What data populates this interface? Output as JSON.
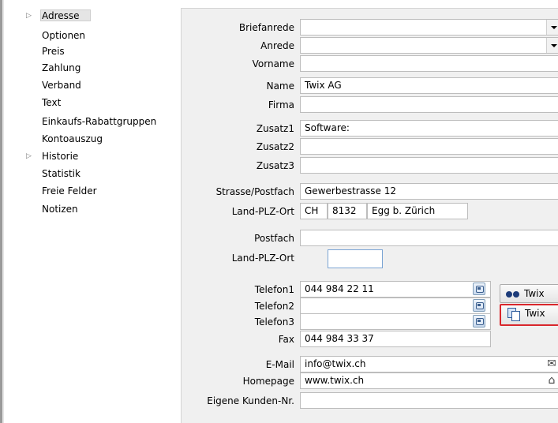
{
  "sidebar": {
    "items": [
      {
        "label": "Adresse",
        "expander": "▷",
        "selected": true
      },
      {
        "label": "Optionen"
      },
      {
        "label": "Preis"
      },
      {
        "label": "Zahlung"
      },
      {
        "label": "Verband"
      },
      {
        "label": "Text"
      },
      {
        "label": "Einkaufs-Rabattgruppen"
      },
      {
        "label": "Kontoauszug"
      },
      {
        "label": "Historie",
        "expander": "▷"
      },
      {
        "label": "Statistik"
      },
      {
        "label": "Freie Felder"
      },
      {
        "label": "Notizen"
      }
    ]
  },
  "form": {
    "briefanrede": {
      "label": "Briefanrede",
      "value": ""
    },
    "anrede": {
      "label": "Anrede",
      "value": ""
    },
    "vorname": {
      "label": "Vorname",
      "value": ""
    },
    "name": {
      "label": "Name",
      "value": "Twix AG"
    },
    "firma": {
      "label": "Firma",
      "value": ""
    },
    "zusatz1": {
      "label": "Zusatz1",
      "value": "Software:"
    },
    "zusatz2": {
      "label": "Zusatz2",
      "value": ""
    },
    "zusatz3": {
      "label": "Zusatz3",
      "value": ""
    },
    "strasse": {
      "label": "Strasse/Postfach",
      "value": "Gewerbestrasse 12"
    },
    "land_plz_ort": {
      "label": "Land-PLZ-Ort",
      "land": "CH",
      "plz": "8132",
      "ort": "Egg b. Zürich"
    },
    "postfach": {
      "label": "Postfach",
      "value": ""
    },
    "land_plz_ort2": {
      "label": "Land-PLZ-Ort",
      "plz": ""
    },
    "telefon1": {
      "label": "Telefon1",
      "value": "044 984 22 11"
    },
    "telefon2": {
      "label": "Telefon2",
      "value": ""
    },
    "telefon3": {
      "label": "Telefon3",
      "value": ""
    },
    "fax": {
      "label": "Fax",
      "value": "044 984 33 37"
    },
    "email": {
      "label": "E-Mail",
      "value": "info@twix.ch"
    },
    "homepage": {
      "label": "Homepage",
      "value": "www.twix.ch"
    },
    "kunden_nr": {
      "label": "Eigene Kunden-Nr.",
      "value": ""
    }
  },
  "buttons": {
    "search_label": "Twix",
    "copy_label": "Twix"
  },
  "icons": {
    "email": "✉",
    "homepage": "⌂"
  },
  "colors": {
    "highlight_border": "#d9262c"
  }
}
